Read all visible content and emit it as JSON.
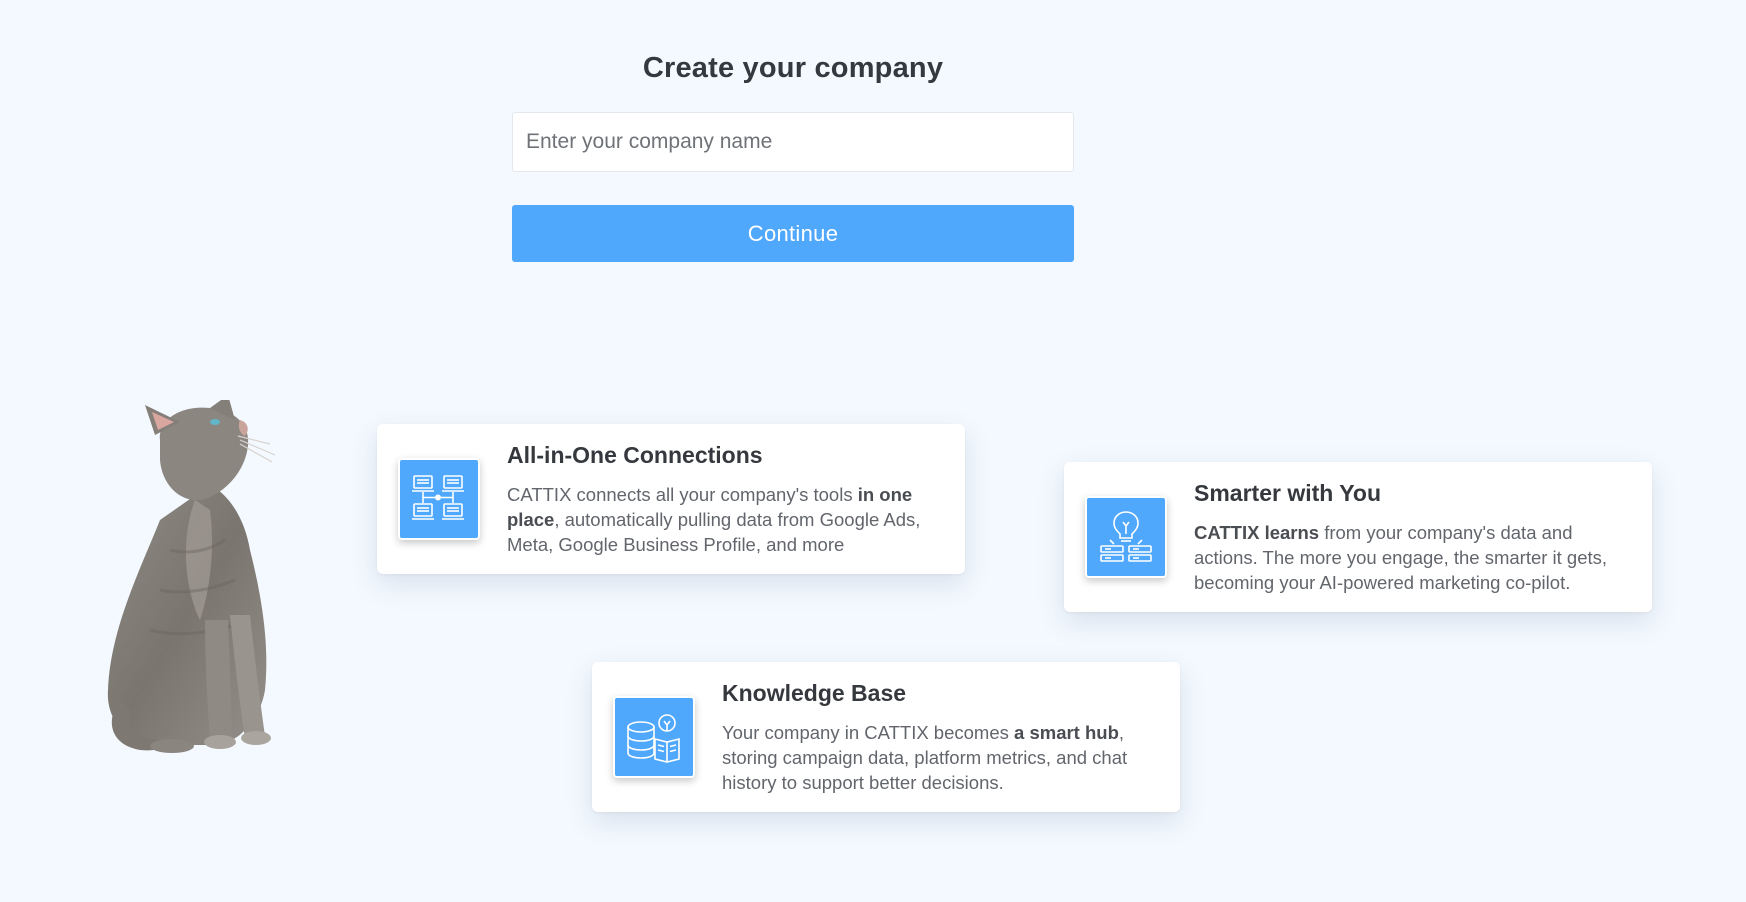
{
  "form": {
    "title": "Create your company",
    "input_placeholder": "Enter your company name",
    "input_value": "",
    "continue_label": "Continue"
  },
  "cards": [
    {
      "title": "All-in-One Connections",
      "icon": "network-devices-icon",
      "desc_parts": [
        {
          "text": "CATTIX connects all your company's tools ",
          "bold": false
        },
        {
          "text": "in one place",
          "bold": true
        },
        {
          "text": ", automatically pulling data from Google Ads, Meta, Google Business Profile, and more",
          "bold": false
        }
      ]
    },
    {
      "title": "Smarter with You",
      "icon": "lightbulb-servers-icon",
      "desc_parts": [
        {
          "text": "CATTIX learns",
          "bold": true
        },
        {
          "text": " from your company's data and actions. The more you engage, the smarter it gets, becoming your AI-powered marketing co-pilot.",
          "bold": false
        }
      ]
    },
    {
      "title": "Knowledge Base",
      "icon": "database-book-icon",
      "desc_parts": [
        {
          "text": "Your company in CATTIX becomes ",
          "bold": false
        },
        {
          "text": "a smart hub",
          "bold": true
        },
        {
          "text": ", storing campaign data, platform metrics, and chat history to support better decisions.",
          "bold": false
        }
      ]
    }
  ],
  "colors": {
    "background": "#f4f9ff",
    "accent": "#4fa8fb",
    "title_text": "#35383d",
    "body_text": "#62666c"
  }
}
